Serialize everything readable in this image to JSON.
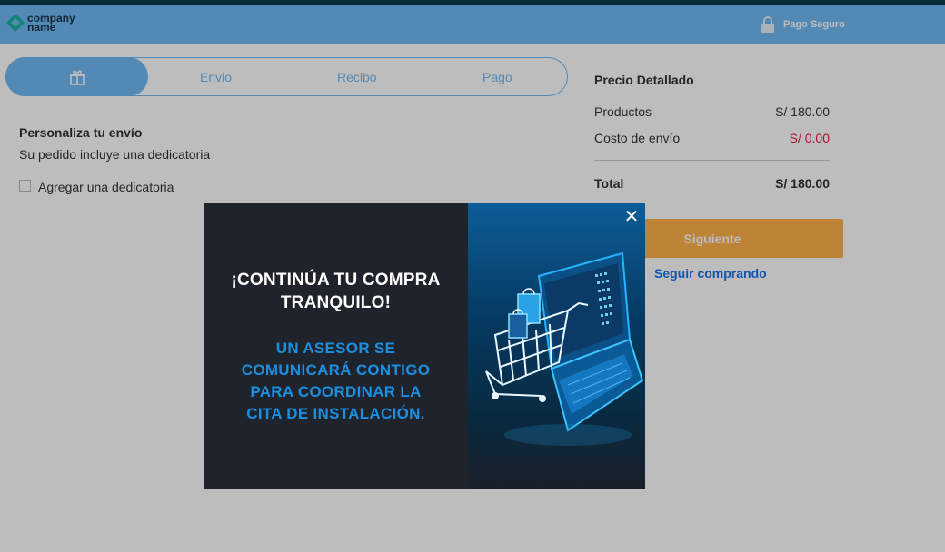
{
  "header": {
    "logo_line1": "company",
    "logo_line2": "name",
    "secure_label": "Pago Seguro"
  },
  "steps": {
    "active_icon": "gift-icon",
    "items": [
      "Envio",
      "Recibo",
      "Pago"
    ]
  },
  "personalize": {
    "title": "Personaliza tu envío",
    "subtitle": "Su pedido incluye una dedicatoria",
    "checkbox_label": "Agregar una dedicatoria"
  },
  "summary": {
    "title": "Precio Detallado",
    "products_label": "Productos",
    "products_value": "S/ 180.00",
    "shipping_label": "Costo de envío",
    "shipping_value": "S/ 0.00",
    "total_label": "Total",
    "total_value": "S/ 180.00"
  },
  "actions": {
    "next_label": "Siguiente",
    "keep_shopping_label": "Seguir comprando"
  },
  "modal": {
    "heading_line1": "¡CONTINÚA TU COMPRA",
    "heading_line2": "TRANQUILO!",
    "body_line1": "UN ASESOR SE",
    "body_line2": "COMUNICARÁ CONTIGO",
    "body_line3": "PARA COORDINAR LA",
    "body_line4": "CITA DE INSTALACIÓN.",
    "close_icon": "close-icon",
    "illustration_icon": "laptop-shopping-cart-icon"
  },
  "colors": {
    "header": "#6fb9f4",
    "accent_button": "#ffb14a",
    "link": "#1a73e8",
    "modal_bg": "#1e232c",
    "modal_body_text": "#1c8fe0"
  }
}
